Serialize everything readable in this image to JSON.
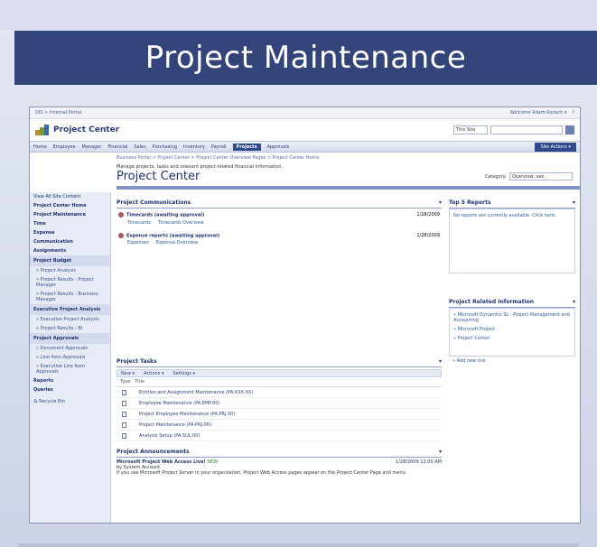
{
  "slide_title": "Project Maintenance",
  "sp": {
    "top_left": "DIS > Internal Portal",
    "top_right": "Welcome Adam Kovach ▾",
    "site_title": "Project Center",
    "search_scope": "This Site",
    "nav": [
      "Home",
      "Employee",
      "Manager",
      "Financial",
      "Sales",
      "Purchasing",
      "Inventory",
      "Payroll",
      "Projects",
      "Approvals"
    ],
    "active_tab": "Projects",
    "site_actions": "Site Actions ▾",
    "breadcrumb": "Business Portal > Project Center > Project Center Overview Pages > Project Center Home",
    "description": "Manage projects, tasks and relevant project-related financial information.",
    "page_title": "Project Center",
    "category_label": "Category:",
    "category_value": "Overview, ask"
  },
  "left_nav": {
    "view_all": "View All Site Content",
    "bold_items": [
      "Project Center Home",
      "Project Maintenance",
      "Time",
      "Expense",
      "Communication",
      "Assignments"
    ],
    "budget_header": "Project Budget",
    "budget_items": [
      "Project Analysis",
      "Project Results - Project Manager",
      "Project Results - Business Manager"
    ],
    "exec_header": "Executive Project Analysis",
    "exec_items": [
      "Executive Project Analysis",
      "Project Results - BI"
    ],
    "approvals_header": "Project Approvals",
    "approval_items": [
      "Document Approvals",
      "Line Item Approvals",
      "Executive Line Item Approvals"
    ],
    "reports": "Reports",
    "queries": "Queries",
    "recycle": "Recycle Bin"
  },
  "communications": {
    "title": "Project Communications",
    "items": [
      {
        "name": "Timecards (awaiting approval)",
        "date": "1/28/2009",
        "a": "Timecards",
        "b": "Timecards Overview"
      },
      {
        "name": "Expense reports (awaiting approval)",
        "date": "1/28/2009",
        "a": "Expenses",
        "b": "Expense Overview"
      }
    ]
  },
  "tasks": {
    "title": "Project Tasks",
    "toolbar": [
      "New ▾",
      "Actions ▾",
      "Settings ▾"
    ],
    "col_type": "Type",
    "col_title": "Title",
    "rows": [
      "Entities and Assignment Maintenance (PA.XXX.XX)",
      "Employee Maintenance (PA.EMP.00)",
      "Project Employee Maintenance (PA.PRJ.00)",
      "Project Maintenance (PA.PRJ.00)",
      "Analysis Setup (PA.SUL.00)"
    ]
  },
  "announcements": {
    "title": "Project Announcements",
    "headline": "Microsoft Project Web Access Live!",
    "new": "NEW",
    "date": "1/28/2009 12:00 AM",
    "author": "by System Account",
    "body": "If you use Microsoft Project Server in your organization, Project Web Access pages appear on the Project Center Page and menu."
  },
  "top5": {
    "title": "Top 5 Reports",
    "body": "No reports are currently available. Click here."
  },
  "related": {
    "title": "Project Related Information",
    "items": [
      "Microsoft Dynamics SL - Project Management and Accounting",
      "Microsoft Project",
      "Project Center"
    ],
    "add": "Add new link"
  }
}
